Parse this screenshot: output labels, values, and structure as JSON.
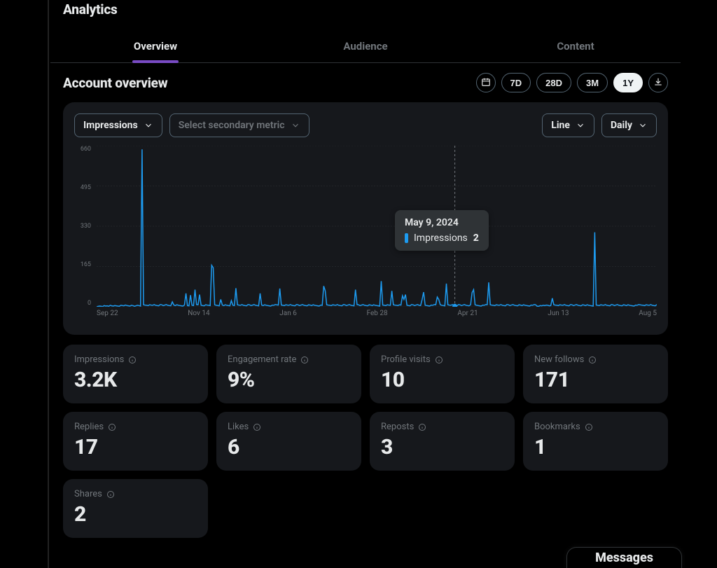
{
  "header": {
    "title": "Analytics"
  },
  "tabs": [
    {
      "label": "Overview",
      "active": true
    },
    {
      "label": "Audience",
      "active": false
    },
    {
      "label": "Content",
      "active": false
    }
  ],
  "subheader": {
    "title": "Account overview",
    "ranges": [
      {
        "label": "7D",
        "active": false
      },
      {
        "label": "28D",
        "active": false
      },
      {
        "label": "3M",
        "active": false
      },
      {
        "label": "1Y",
        "active": true
      }
    ]
  },
  "chart_controls": {
    "primary_metric": "Impressions",
    "secondary_placeholder": "Select secondary metric",
    "viz_type": "Line",
    "granularity": "Daily"
  },
  "tooltip": {
    "date": "May 9, 2024",
    "metric": "Impressions",
    "value": "2"
  },
  "chart_data": {
    "type": "line",
    "title": "",
    "xlabel": "",
    "ylabel": "",
    "ylim": [
      0,
      660
    ],
    "y_ticks": [
      "660",
      "495",
      "330",
      "165",
      "0"
    ],
    "x_ticks": [
      "Sep 22",
      "Nov 14",
      "Jan 6",
      "Feb 28",
      "Apr 21",
      "Jun 13",
      "Aug 5"
    ],
    "cursor_x_frac": 0.6395,
    "series": [
      {
        "name": "Impressions",
        "color": "#1d9bf0",
        "values_daily_est": [
          0,
          2,
          3,
          2,
          1,
          5,
          3,
          4,
          2,
          6,
          4,
          3,
          5,
          4,
          3,
          2,
          6,
          5,
          4,
          7,
          5,
          4,
          3,
          6,
          5,
          2,
          4,
          6,
          5,
          3,
          645,
          8,
          7,
          6,
          5,
          8,
          7,
          6,
          9,
          6,
          5,
          4,
          9,
          8,
          5,
          7,
          9,
          6,
          5,
          4,
          20,
          7,
          5,
          8,
          6,
          5,
          4,
          3,
          7,
          55,
          5,
          4,
          48,
          6,
          5,
          70,
          9,
          8,
          50,
          6,
          5,
          4,
          8,
          7,
          6,
          5,
          170,
          160,
          8,
          6,
          5,
          4,
          30,
          7,
          5,
          8,
          6,
          5,
          4,
          25,
          6,
          5,
          76,
          8,
          7,
          6,
          9,
          6,
          5,
          4,
          9,
          8,
          5,
          7,
          9,
          6,
          5,
          4,
          55,
          7,
          5,
          8,
          6,
          5,
          4,
          3,
          7,
          6,
          9,
          8,
          7,
          75,
          7,
          6,
          5,
          8,
          7,
          6,
          9,
          6,
          5,
          4,
          9,
          8,
          5,
          7,
          9,
          6,
          5,
          4,
          8,
          7,
          5,
          8,
          6,
          5,
          4,
          3,
          7,
          6,
          85,
          65,
          8,
          7,
          6,
          5,
          8,
          7,
          6,
          9,
          6,
          5,
          4,
          9,
          8,
          5,
          7,
          9,
          6,
          5,
          4,
          70,
          9,
          8,
          5,
          7,
          9,
          6,
          5,
          4,
          8,
          7,
          5,
          8,
          6,
          5,
          4,
          3,
          105,
          7,
          6,
          5,
          8,
          7,
          6,
          65,
          8,
          7,
          6,
          5,
          8,
          7,
          45,
          30,
          50,
          6,
          5,
          4,
          9,
          8,
          5,
          7,
          9,
          6,
          5,
          30,
          60,
          6,
          5,
          4,
          3,
          7,
          6,
          9,
          8,
          40,
          30,
          8,
          6,
          5,
          4,
          95,
          8,
          7,
          6,
          9,
          6,
          5,
          4,
          9,
          8,
          5,
          7,
          9,
          6,
          5,
          4,
          8,
          58,
          70,
          8,
          6,
          5,
          4,
          3,
          7,
          6,
          9,
          8,
          100,
          8,
          7,
          6,
          5,
          8,
          7,
          6,
          9,
          6,
          5,
          4,
          9,
          8,
          5,
          7,
          9,
          6,
          5,
          4,
          8,
          7,
          5,
          8,
          6,
          5,
          4,
          3,
          7,
          6,
          9,
          8,
          2,
          2,
          5,
          4,
          6,
          5,
          7,
          6,
          4,
          5,
          35,
          8,
          7,
          6,
          5,
          8,
          7,
          6,
          9,
          6,
          5,
          4,
          9,
          8,
          5,
          7,
          9,
          6,
          5,
          4,
          8,
          7,
          5,
          8,
          6,
          5,
          4,
          3,
          305,
          7,
          6,
          5,
          8,
          7,
          6,
          9,
          6,
          5,
          4,
          9,
          8,
          5,
          7,
          9,
          6,
          5,
          4,
          8,
          7,
          5,
          8,
          6,
          5,
          4,
          3,
          7,
          6,
          9,
          8,
          7,
          6,
          5,
          8,
          7,
          6,
          9,
          6,
          5,
          4,
          9
        ]
      }
    ]
  },
  "metrics": [
    {
      "label": "Impressions",
      "value": "3.2K"
    },
    {
      "label": "Engagement rate",
      "value": "9%"
    },
    {
      "label": "Profile visits",
      "value": "10"
    },
    {
      "label": "New follows",
      "value": "171"
    },
    {
      "label": "Replies",
      "value": "17"
    },
    {
      "label": "Likes",
      "value": "6"
    },
    {
      "label": "Reposts",
      "value": "3"
    },
    {
      "label": "Bookmarks",
      "value": "1"
    },
    {
      "label": "Shares",
      "value": "2"
    }
  ],
  "messages_peek": "Messages"
}
